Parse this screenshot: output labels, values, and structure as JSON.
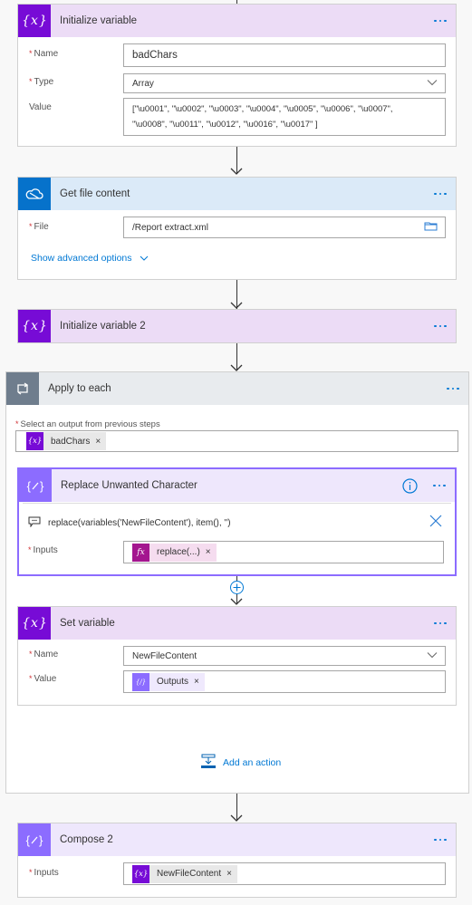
{
  "steps": {
    "init_var": {
      "title": "Initialize variable",
      "icon": "variable-icon",
      "name_label": "Name",
      "name_value": "badChars",
      "type_label": "Type",
      "type_value": "Array",
      "value_label": "Value",
      "value_line1": "[\"\\u0001\", \"\\u0002\", \"\\u0003\", \"\\u0004\", \"\\u0005\", \"\\u0006\", \"\\u0007\",",
      "value_line2": "\"\\u0008\", \"\\u0011\", \"\\u0012\", \"\\u0016\", \"\\u0017\" ]"
    },
    "get_file": {
      "title": "Get file content",
      "icon": "onedrive-cloud-icon",
      "file_label": "File",
      "file_value": "/Report extract.xml",
      "advanced_label": "Show advanced options"
    },
    "init_var2": {
      "title": "Initialize variable 2",
      "icon": "variable-icon"
    },
    "apply_each": {
      "title": "Apply to each",
      "icon": "loop-icon",
      "select_label": "Select an output from previous steps",
      "token_label": "badChars",
      "add_action_label": "Add an action"
    },
    "replace": {
      "title": "Replace Unwanted Character",
      "icon": "compose-icon",
      "expression": "replace(variables('NewFileContent'), item(), '')",
      "inputs_label": "Inputs",
      "token_label": "replace(...)"
    },
    "set_var": {
      "title": "Set variable",
      "icon": "variable-icon",
      "name_label": "Name",
      "name_value": "NewFileContent",
      "value_label": "Value",
      "token_label": "Outputs"
    },
    "compose2": {
      "title": "Compose 2",
      "icon": "compose-icon",
      "inputs_label": "Inputs",
      "token_label": "NewFileContent"
    }
  },
  "required_mark": "*",
  "colors": {
    "variable": "#770bd6",
    "onedrive": "#0672cb",
    "loop": "#6f7d8d",
    "compose": "#8c6cff",
    "expression": "#a4168f",
    "accent": "#0078d4"
  }
}
